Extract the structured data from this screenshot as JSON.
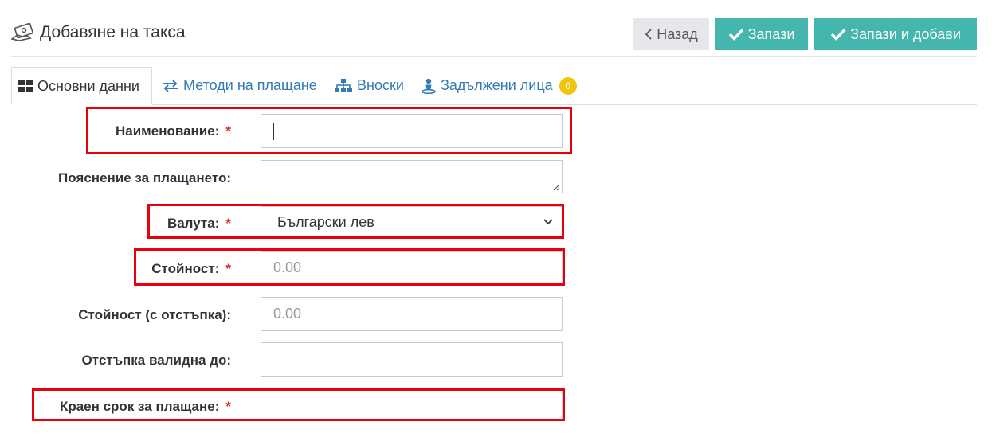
{
  "header": {
    "title": "Добавяне на такса"
  },
  "toolbar": {
    "back_label": "Назад",
    "save_label": "Запази",
    "save_add_label": "Запази и добави"
  },
  "tabs": [
    {
      "label": "Основни данни",
      "icon": "grid-icon",
      "active": true
    },
    {
      "label": "Методи на плащане",
      "icon": "exchange-icon"
    },
    {
      "label": "Вноски",
      "icon": "sitemap-icon"
    },
    {
      "label": "Задължени лица",
      "icon": "person-icon",
      "badge": "0"
    }
  ],
  "form": {
    "name": {
      "label": "Наименование:",
      "required": "*",
      "value": ""
    },
    "description": {
      "label": "Пояснение за плащането:",
      "value": ""
    },
    "currency": {
      "label": "Валута:",
      "required": "*",
      "value": "Български лев"
    },
    "amount": {
      "label": "Стойност:",
      "required": "*",
      "placeholder": "0.00"
    },
    "discount_amount": {
      "label": "Стойност (с отстъпка):",
      "placeholder": "0.00"
    },
    "discount_until": {
      "label": "Отстъпка валидна до:",
      "value": ""
    },
    "deadline": {
      "label": "Краен срок за плащане:",
      "required": "*",
      "value": ""
    }
  },
  "colors": {
    "accent": "#44b6ae",
    "highlight": "#e8000b",
    "required": "#e02222",
    "badge": "#f1c40f",
    "link": "#337ab7"
  }
}
